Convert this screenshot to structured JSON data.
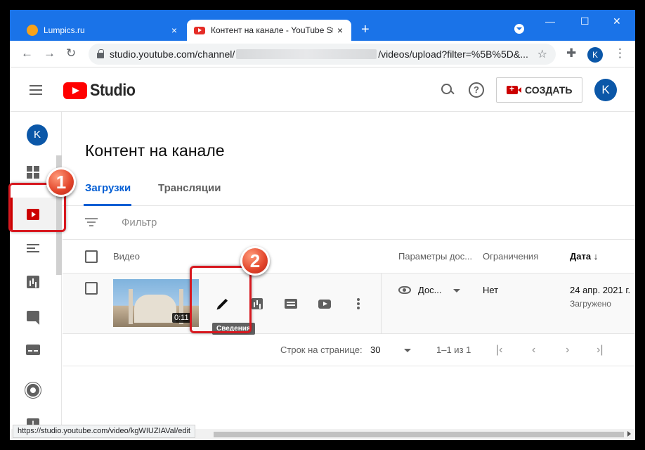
{
  "browser": {
    "tabs": [
      {
        "title": "Lumpics.ru",
        "active": false
      },
      {
        "title": "Контент на канале - YouTube St",
        "active": true
      }
    ],
    "tab_close": "×",
    "new_tab": "+",
    "window_controls": {
      "minimize": "—",
      "maximize": "☐",
      "close": "✕"
    },
    "url_prefix": "studio.youtube.com/channel/",
    "url_suffix": "/videos/upload?filter=%5B%5D&...",
    "profile_initial": "K",
    "status_url": "https://studio.youtube.com/video/kgWIUZIAVal/edit"
  },
  "header": {
    "logo_text": "Studio",
    "create_label": "СОЗДАТЬ",
    "avatar_initial": "K"
  },
  "sidebar": {
    "avatar_initial": "K",
    "items": [
      "dashboard",
      "content",
      "playlists",
      "analytics",
      "comments",
      "subtitles",
      "settings",
      "feedback"
    ],
    "active_item": "content"
  },
  "main": {
    "title": "Контент на канале",
    "tabs": [
      {
        "label": "Загрузки",
        "active": true
      },
      {
        "label": "Трансляции",
        "active": false
      }
    ],
    "filter_placeholder": "Фильтр",
    "columns": {
      "video": "Видео",
      "visibility": "Параметры дос...",
      "restrictions": "Ограничения",
      "date": "Дата",
      "date_sort": "↓"
    },
    "rows": [
      {
        "duration": "0:11",
        "visibility": "Дос...",
        "restrictions": "Нет",
        "date": "24 апр. 2021 г.",
        "date_status": "Загружено"
      }
    ],
    "tooltip": "Сведения",
    "pager": {
      "rows_label": "Строк на странице:",
      "rows_value": "30",
      "range": "1–1 из 1"
    }
  },
  "callouts": [
    {
      "number": "1"
    },
    {
      "number": "2"
    }
  ],
  "colors": {
    "chrome_blue": "#1a73e8",
    "youtube_red": "#ff0000",
    "active_tab_blue": "#065fd4",
    "callout_red": "#d71920"
  }
}
